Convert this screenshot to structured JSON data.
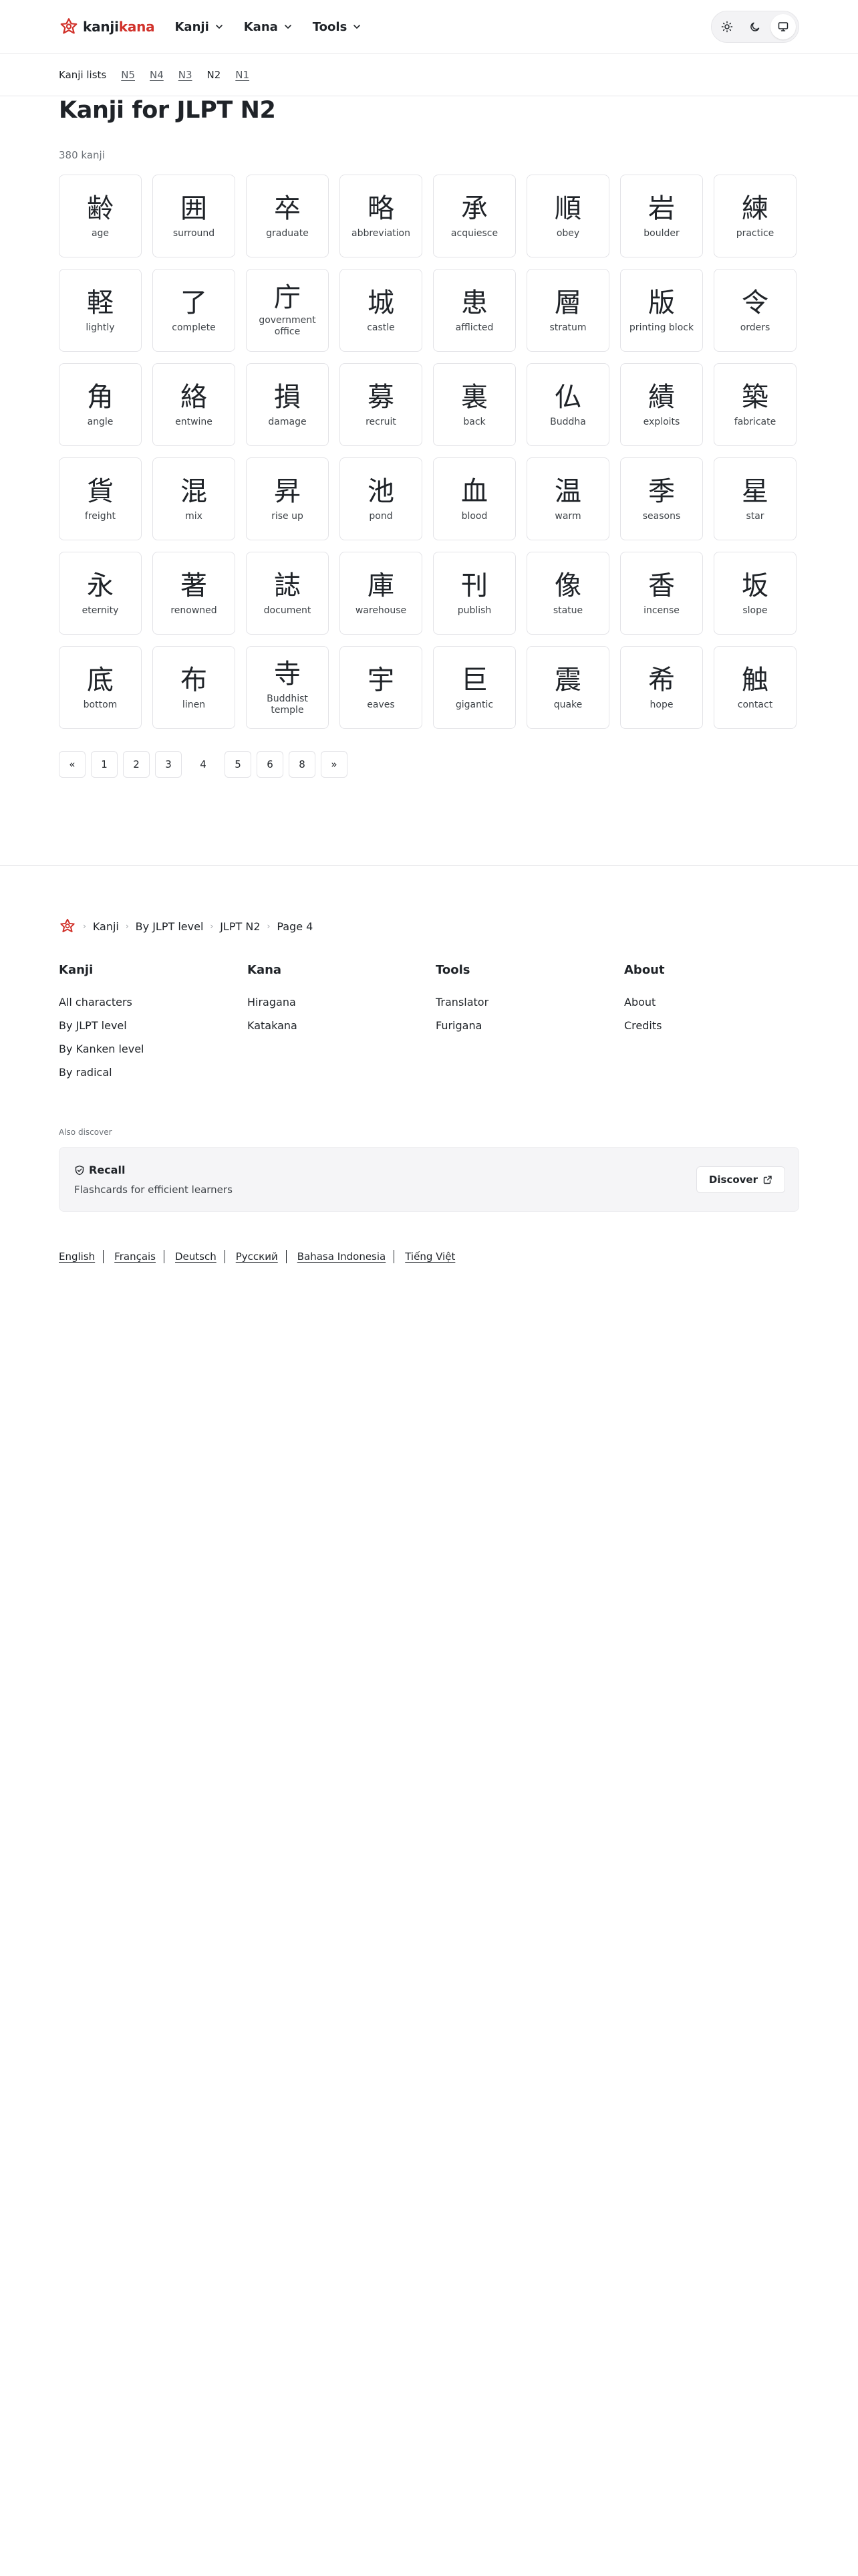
{
  "header": {
    "logo_part1": "kanji",
    "logo_part2": "kana",
    "nav": [
      "Kanji",
      "Kana",
      "Tools"
    ],
    "theme_icons": [
      "sun-icon",
      "moon-icon",
      "monitor-icon"
    ],
    "brand_color": "#d1322b"
  },
  "subnav": {
    "label": "Kanji lists",
    "levels": [
      "N5",
      "N4",
      "N3",
      "N2",
      "N1"
    ],
    "current": "N2"
  },
  "main": {
    "title": "Kanji for JLPT N2",
    "count": "380 kanji",
    "kanji": [
      {
        "char": "齢",
        "meaning": "age"
      },
      {
        "char": "囲",
        "meaning": "surround"
      },
      {
        "char": "卒",
        "meaning": "graduate"
      },
      {
        "char": "略",
        "meaning": "abbreviation"
      },
      {
        "char": "承",
        "meaning": "acquiesce"
      },
      {
        "char": "順",
        "meaning": "obey"
      },
      {
        "char": "岩",
        "meaning": "boulder"
      },
      {
        "char": "練",
        "meaning": "practice"
      },
      {
        "char": "軽",
        "meaning": "lightly"
      },
      {
        "char": "了",
        "meaning": "complete"
      },
      {
        "char": "庁",
        "meaning": "government office"
      },
      {
        "char": "城",
        "meaning": "castle"
      },
      {
        "char": "患",
        "meaning": "afflicted"
      },
      {
        "char": "層",
        "meaning": "stratum"
      },
      {
        "char": "版",
        "meaning": "printing block"
      },
      {
        "char": "令",
        "meaning": "orders"
      },
      {
        "char": "角",
        "meaning": "angle"
      },
      {
        "char": "絡",
        "meaning": "entwine"
      },
      {
        "char": "損",
        "meaning": "damage"
      },
      {
        "char": "募",
        "meaning": "recruit"
      },
      {
        "char": "裏",
        "meaning": "back"
      },
      {
        "char": "仏",
        "meaning": "Buddha"
      },
      {
        "char": "績",
        "meaning": "exploits"
      },
      {
        "char": "築",
        "meaning": "fabricate"
      },
      {
        "char": "貨",
        "meaning": "freight"
      },
      {
        "char": "混",
        "meaning": "mix"
      },
      {
        "char": "昇",
        "meaning": "rise up"
      },
      {
        "char": "池",
        "meaning": "pond"
      },
      {
        "char": "血",
        "meaning": "blood"
      },
      {
        "char": "温",
        "meaning": "warm"
      },
      {
        "char": "季",
        "meaning": "seasons"
      },
      {
        "char": "星",
        "meaning": "star"
      },
      {
        "char": "永",
        "meaning": "eternity"
      },
      {
        "char": "著",
        "meaning": "renowned"
      },
      {
        "char": "誌",
        "meaning": "document"
      },
      {
        "char": "庫",
        "meaning": "warehouse"
      },
      {
        "char": "刊",
        "meaning": "publish"
      },
      {
        "char": "像",
        "meaning": "statue"
      },
      {
        "char": "香",
        "meaning": "incense"
      },
      {
        "char": "坂",
        "meaning": "slope"
      },
      {
        "char": "底",
        "meaning": "bottom"
      },
      {
        "char": "布",
        "meaning": "linen"
      },
      {
        "char": "寺",
        "meaning": "Buddhist temple"
      },
      {
        "char": "宇",
        "meaning": "eaves"
      },
      {
        "char": "巨",
        "meaning": "gigantic"
      },
      {
        "char": "震",
        "meaning": "quake"
      },
      {
        "char": "希",
        "meaning": "hope"
      },
      {
        "char": "触",
        "meaning": "contact"
      }
    ]
  },
  "pagination": {
    "prev": "«",
    "pages": [
      "1",
      "2",
      "3",
      "4",
      "5",
      "6",
      "8"
    ],
    "current": "4",
    "next": "»"
  },
  "footer": {
    "breadcrumb": [
      "Kanji",
      "By JLPT level",
      "JLPT N2",
      "Page 4"
    ],
    "columns": [
      {
        "title": "Kanji",
        "links": [
          "All characters",
          "By JLPT level",
          "By Kanken level",
          "By radical"
        ]
      },
      {
        "title": "Kana",
        "links": [
          "Hiragana",
          "Katakana"
        ]
      },
      {
        "title": "Tools",
        "links": [
          "Translator",
          "Furigana"
        ]
      },
      {
        "title": "About",
        "links": [
          "About",
          "Credits"
        ]
      }
    ],
    "also_discover": "Also discover",
    "promo": {
      "title": "Recall",
      "subtitle": "Flashcards for efficient learners",
      "button": "Discover"
    },
    "languages": [
      "English",
      "Français",
      "Deutsch",
      "Русский",
      "Bahasa Indonesia",
      "Tiếng Việt"
    ]
  }
}
